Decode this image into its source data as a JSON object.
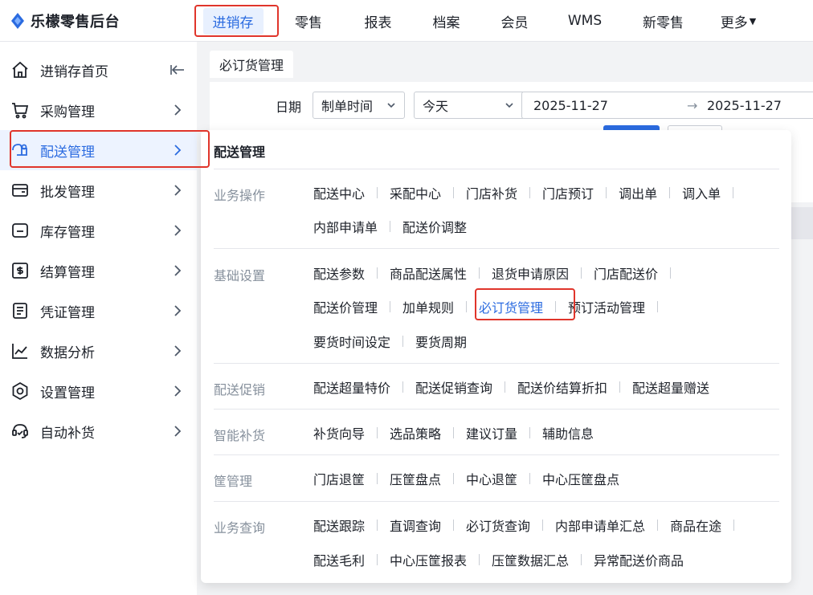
{
  "brand": {
    "name": "乐檬零售后台",
    "logo_icon": "diamond-logo-icon",
    "color": "#2b6be0"
  },
  "top_nav": {
    "items": [
      {
        "label": "进销存",
        "active": true
      },
      {
        "label": "零售"
      },
      {
        "label": "报表"
      },
      {
        "label": "档案"
      },
      {
        "label": "会员"
      },
      {
        "label": "WMS"
      },
      {
        "label": "新零售"
      },
      {
        "label": "更多"
      }
    ]
  },
  "sidebar": {
    "items": [
      {
        "label": "进销存首页",
        "icon": "home-icon"
      },
      {
        "label": "采购管理",
        "icon": "cart-icon"
      },
      {
        "label": "配送管理",
        "icon": "delivery-icon",
        "active": true
      },
      {
        "label": "批发管理",
        "icon": "wallet-icon"
      },
      {
        "label": "库存管理",
        "icon": "inventory-icon"
      },
      {
        "label": "结算管理",
        "icon": "settlement-icon"
      },
      {
        "label": "凭证管理",
        "icon": "voucher-icon"
      },
      {
        "label": "数据分析",
        "icon": "chart-line-icon"
      },
      {
        "label": "设置管理",
        "icon": "settings-icon"
      },
      {
        "label": "自动补货",
        "icon": "auto-replenish-icon"
      }
    ]
  },
  "main": {
    "tab_label": "必订货管理",
    "filter": {
      "date_label": "日期",
      "date_type": "制单时间",
      "date_preset": "今天",
      "date_from": "2025-11-27",
      "range_separator": "→",
      "date_to": "2025-11-27"
    }
  },
  "flyout": {
    "title": "配送管理",
    "groups": [
      {
        "label": "业务操作",
        "rows": [
          [
            "配送中心",
            "采配中心",
            "门店补货",
            "门店预订",
            "调出单",
            "调入单"
          ],
          [
            "内部申请单",
            "配送价调整"
          ]
        ]
      },
      {
        "label": "基础设置",
        "rows": [
          [
            "配送参数",
            "商品配送属性",
            "退货申请原因",
            "门店配送价"
          ],
          [
            "配送价管理",
            "加单规则",
            "必订货管理",
            "预订活动管理"
          ],
          [
            "要货时间设定",
            "要货周期"
          ]
        ]
      },
      {
        "label": "配送促销",
        "rows": [
          [
            "配送超量特价",
            "配送促销查询",
            "配送价结算折扣",
            "配送超量赠送"
          ]
        ]
      },
      {
        "label": "智能补货",
        "rows": [
          [
            "补货向导",
            "选品策略",
            "建议订量",
            "辅助信息"
          ]
        ]
      },
      {
        "label": "筐管理",
        "rows": [
          [
            "门店退筐",
            "压筐盘点",
            "中心退筐",
            "中心压筐盘点"
          ]
        ]
      },
      {
        "label": "业务查询",
        "rows": [
          [
            "配送跟踪",
            "直调查询",
            "必订货查询",
            "内部申请单汇总",
            "商品在途"
          ],
          [
            "配送毛利",
            "中心压筐报表",
            "压筐数据汇总",
            "异常配送价商品"
          ]
        ]
      }
    ]
  },
  "colors": {
    "accent": "#2b6be0",
    "highlight_border": "#e0352b",
    "muted_text": "#86909c"
  }
}
